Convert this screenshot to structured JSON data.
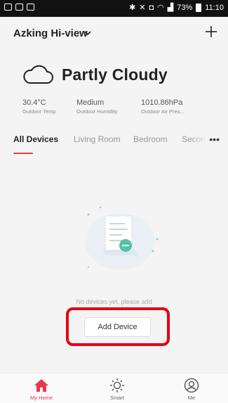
{
  "status_bar": {
    "battery": "73%",
    "time": "11:10"
  },
  "header": {
    "home_name": "Azking Hi-view"
  },
  "weather": {
    "condition": "Partly Cloudy",
    "stats": [
      {
        "value": "30.4°C",
        "label": "Outdoor Temp"
      },
      {
        "value": "Medium",
        "label": "Outdoor Humidity"
      },
      {
        "value": "1010.86hPa",
        "label": "Outdoor Air Pres..."
      }
    ]
  },
  "tabs": [
    {
      "label": "All Devices",
      "active": true
    },
    {
      "label": "Living Room",
      "active": false
    },
    {
      "label": "Bedroom",
      "active": false
    },
    {
      "label": "Secon",
      "active": false
    }
  ],
  "empty_state": {
    "message": "No devices yet, please add",
    "button_label": "Add Device"
  },
  "bottom_nav": [
    {
      "label": "My Home",
      "icon": "home-icon",
      "active": true
    },
    {
      "label": "Smart",
      "icon": "sun-icon",
      "active": false
    },
    {
      "label": "Me",
      "icon": "user-icon",
      "active": false
    }
  ],
  "colors": {
    "accent": "#e8394a",
    "highlight": "#e8000f"
  }
}
